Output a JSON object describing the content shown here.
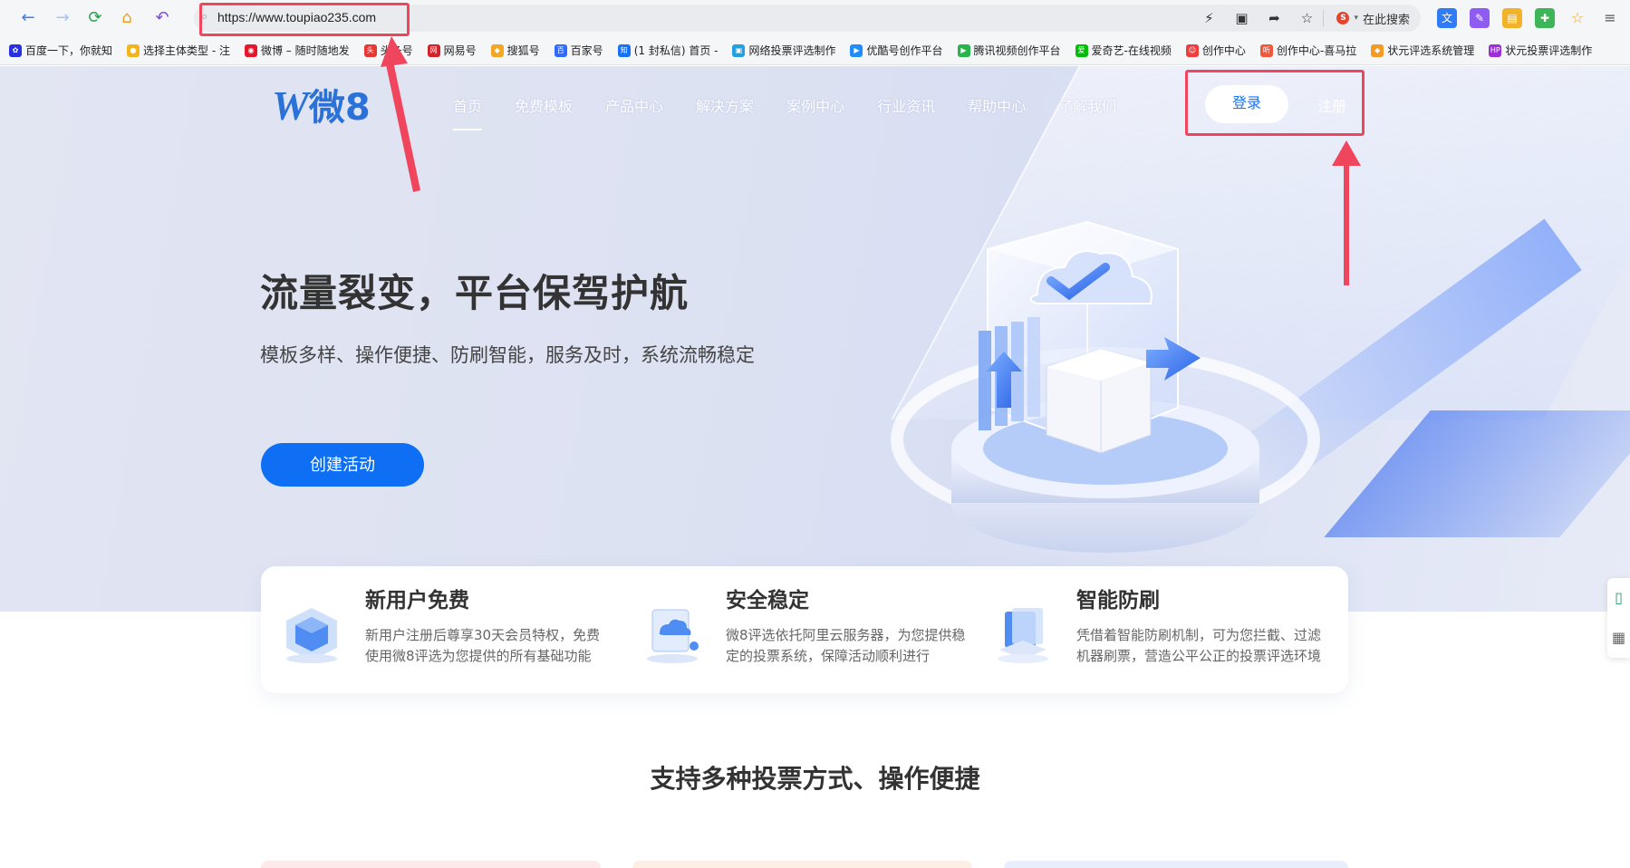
{
  "browser": {
    "url": "https://www.toupiao235.com",
    "search_placeholder": "在此搜索",
    "bookmarks": [
      {
        "label": "百度一下，你就知",
        "color": "#2932e1",
        "glyph": "✿"
      },
      {
        "label": "选择主体类型 - 注",
        "color": "#f2b51d",
        "glyph": "●"
      },
      {
        "label": "微博 – 随时随地发",
        "color": "#e6162d",
        "glyph": "◉"
      },
      {
        "label": "头条号",
        "color": "#e53935",
        "glyph": "头"
      },
      {
        "label": "网易号",
        "color": "#d2232a",
        "glyph": "网"
      },
      {
        "label": "搜狐号",
        "color": "#f5a623",
        "glyph": "◆"
      },
      {
        "label": "百家号",
        "color": "#2f6bff",
        "glyph": "百"
      },
      {
        "label": "(1 封私信) 首页 -",
        "color": "#1772f6",
        "glyph": "知"
      },
      {
        "label": "网络投票评选制作",
        "color": "#23a0e2",
        "glyph": "▣"
      },
      {
        "label": "优酷号创作平台",
        "color": "#1f8cff",
        "glyph": "▶"
      },
      {
        "label": "腾讯视频创作平台",
        "color": "#27b54b",
        "glyph": "▶"
      },
      {
        "label": "爱奇艺-在线视频",
        "color": "#00be06",
        "glyph": "爱"
      },
      {
        "label": "创作中心",
        "color": "#f03c3c",
        "glyph": "☺"
      },
      {
        "label": "创作中心-喜马拉",
        "color": "#f0573c",
        "glyph": "听"
      },
      {
        "label": "状元评选系统管理",
        "color": "#f59a23",
        "glyph": "◆"
      },
      {
        "label": "状元投票评选制作",
        "color": "#9b2fd8",
        "glyph": "HP"
      }
    ]
  },
  "site": {
    "logo_letter": "W",
    "logo_text": "微8",
    "nav": [
      "首页",
      "免费模板",
      "产品中心",
      "解决方案",
      "案例中心",
      "行业资讯",
      "帮助中心",
      "了解我们"
    ],
    "login": "登录",
    "register": "注册"
  },
  "hero": {
    "title": "流量裂变，平台保驾护航",
    "subtitle": "模板多样、操作便捷、防刷智能，服务及时，系统流畅稳定",
    "cta": "创建活动"
  },
  "features": [
    {
      "title": "新用户免费",
      "desc": "新用户注册后尊享30天会员特权，免费使用微8评选为您提供的所有基础功能"
    },
    {
      "title": "安全稳定",
      "desc": "微8评选依托阿里云服务器，为您提供稳定的投票系统，保障活动顺利进行"
    },
    {
      "title": "智能防刷",
      "desc": "凭借着智能防刷机制，可为您拦截、过滤机器刷票，营造公平公正的投票评选环境"
    }
  ],
  "section": {
    "title": "支持多种投票方式、操作便捷"
  },
  "colors": {
    "primary": "#0e6ff5",
    "annotation": "#f0465d",
    "logo": "#2a72d8"
  }
}
